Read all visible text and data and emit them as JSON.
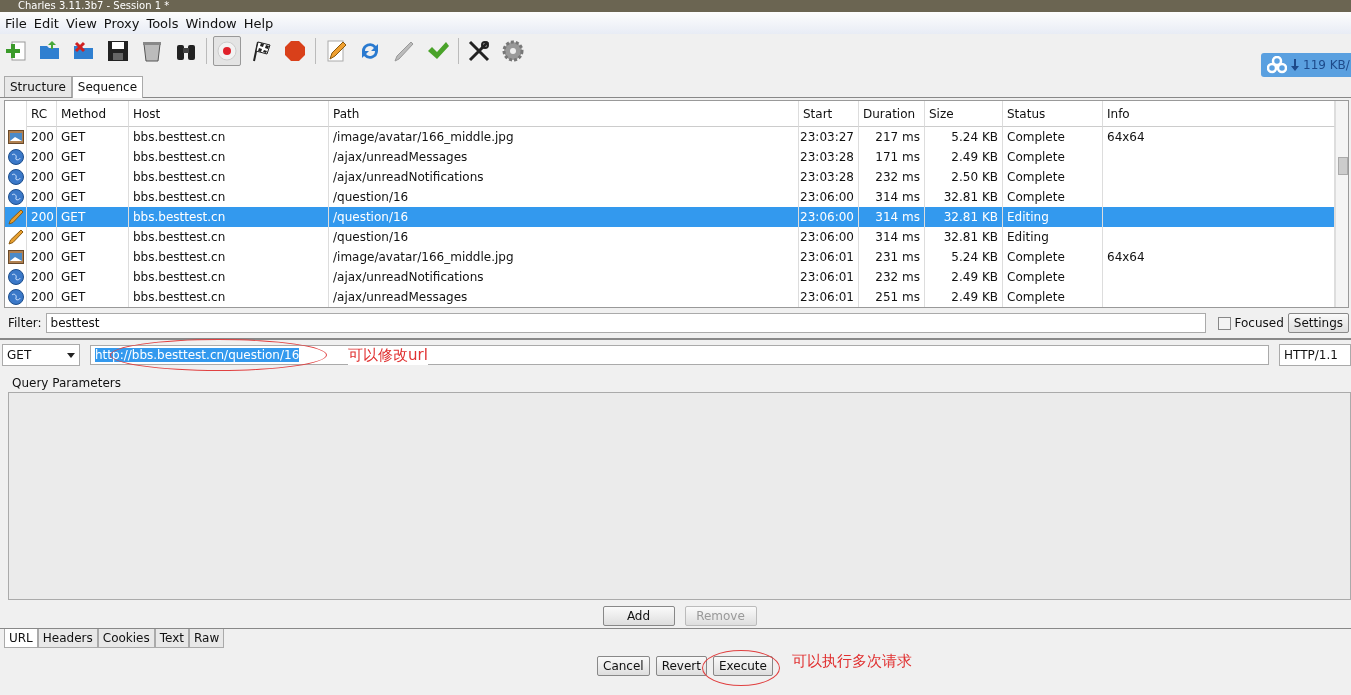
{
  "window": {
    "title": "Charles 3.11.3b7 - Session 1 *"
  },
  "menu": [
    "File",
    "Edit",
    "View",
    "Proxy",
    "Tools",
    "Window",
    "Help"
  ],
  "toolbar": [
    {
      "kind": "new"
    },
    {
      "kind": "open"
    },
    {
      "kind": "close"
    },
    {
      "kind": "save"
    },
    {
      "kind": "trash"
    },
    {
      "kind": "binoculars"
    },
    {
      "kind": "sep"
    },
    {
      "kind": "record",
      "selected": true
    },
    {
      "kind": "flag"
    },
    {
      "kind": "stop"
    },
    {
      "kind": "sep"
    },
    {
      "kind": "edit"
    },
    {
      "kind": "refresh"
    },
    {
      "kind": "pen"
    },
    {
      "kind": "check"
    },
    {
      "kind": "sep"
    },
    {
      "kind": "tools"
    },
    {
      "kind": "gear"
    }
  ],
  "speed_widget": {
    "text": "119 KB/"
  },
  "view_tabs": [
    {
      "label": "Structure",
      "selected": false
    },
    {
      "label": "Sequence",
      "selected": true
    }
  ],
  "table": {
    "columns": [
      "RC",
      "Method",
      "Host",
      "Path",
      "Start",
      "Duration",
      "Size",
      "Status",
      "Info"
    ],
    "rows": [
      {
        "kind": "image",
        "selected": false,
        "cells": [
          "200",
          "GET",
          "bbs.besttest.cn",
          "/image/avatar/166_middle.jpg",
          "23:03:27",
          "217 ms",
          "5.24 KB",
          "Complete",
          "64x64"
        ]
      },
      {
        "kind": "globe",
        "selected": false,
        "cells": [
          "200",
          "GET",
          "bbs.besttest.cn",
          "/ajax/unreadMessages",
          "23:03:28",
          "171 ms",
          "2.49 KB",
          "Complete",
          ""
        ]
      },
      {
        "kind": "globe",
        "selected": false,
        "cells": [
          "200",
          "GET",
          "bbs.besttest.cn",
          "/ajax/unreadNotifications",
          "23:03:28",
          "232 ms",
          "2.50 KB",
          "Complete",
          ""
        ]
      },
      {
        "kind": "globe",
        "selected": false,
        "cells": [
          "200",
          "GET",
          "bbs.besttest.cn",
          "/question/16",
          "23:06:00",
          "314 ms",
          "32.81 KB",
          "Complete",
          ""
        ]
      },
      {
        "kind": "edit",
        "selected": true,
        "cells": [
          "200",
          "GET",
          "bbs.besttest.cn",
          "/question/16",
          "23:06:00",
          "314 ms",
          "32.81 KB",
          "Editing",
          ""
        ]
      },
      {
        "kind": "edit",
        "selected": false,
        "cells": [
          "200",
          "GET",
          "bbs.besttest.cn",
          "/question/16",
          "23:06:00",
          "314 ms",
          "32.81 KB",
          "Editing",
          ""
        ]
      },
      {
        "kind": "image",
        "selected": false,
        "cells": [
          "200",
          "GET",
          "bbs.besttest.cn",
          "/image/avatar/166_middle.jpg",
          "23:06:01",
          "231 ms",
          "5.24 KB",
          "Complete",
          "64x64"
        ]
      },
      {
        "kind": "globe",
        "selected": false,
        "cells": [
          "200",
          "GET",
          "bbs.besttest.cn",
          "/ajax/unreadNotifications",
          "23:06:01",
          "232 ms",
          "2.49 KB",
          "Complete",
          ""
        ]
      },
      {
        "kind": "globe",
        "selected": false,
        "cells": [
          "200",
          "GET",
          "bbs.besttest.cn",
          "/ajax/unreadMessages",
          "23:06:01",
          "251 ms",
          "2.49 KB",
          "Complete",
          ""
        ]
      }
    ]
  },
  "filter": {
    "label": "Filter:",
    "value": "besttest",
    "focused_label": "Focused",
    "focused_checked": false,
    "settings": "Settings"
  },
  "request": {
    "method": "GET",
    "url": "http://bbs.besttest.cn/question/16",
    "protocol": "HTTP/1.1",
    "url_note": "可以修改url"
  },
  "params": {
    "label": "Query Parameters",
    "add": "Add",
    "remove": "Remove",
    "remove_disabled": true
  },
  "editor_tabs": [
    {
      "label": "URL",
      "selected": true
    },
    {
      "label": "Headers",
      "selected": false
    },
    {
      "label": "Cookies",
      "selected": false
    },
    {
      "label": "Text",
      "selected": false
    },
    {
      "label": "Raw",
      "selected": false
    }
  ],
  "actions": [
    "Cancel",
    "Revert",
    "Execute"
  ],
  "execute_note": "可以执行多次请求"
}
